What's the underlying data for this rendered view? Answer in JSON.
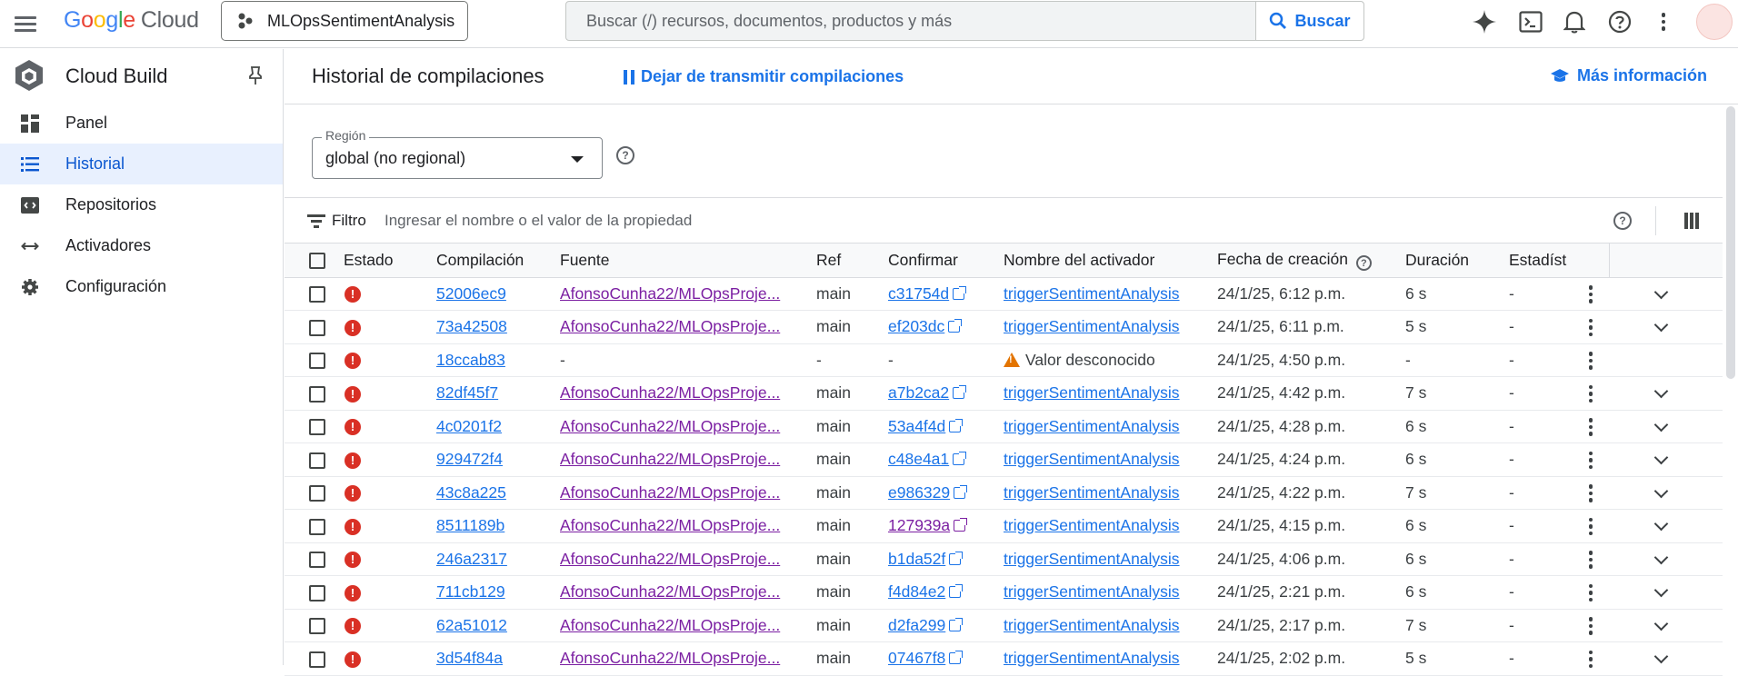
{
  "header": {
    "logo_google": "Google",
    "logo_cloud": "Cloud",
    "project": "MLOpsSentimentAnalysis",
    "search_placeholder": "Buscar (/) recursos, documentos, productos y más",
    "search_button": "Buscar"
  },
  "sidebar": {
    "title": "Cloud Build",
    "items": [
      {
        "label": "Panel",
        "icon": "dashboard-icon"
      },
      {
        "label": "Historial",
        "icon": "list-icon",
        "active": true
      },
      {
        "label": "Repositorios",
        "icon": "repository-icon"
      },
      {
        "label": "Activadores",
        "icon": "trigger-arrows-icon"
      },
      {
        "label": "Configuración",
        "icon": "gear-icon"
      }
    ]
  },
  "page": {
    "title": "Historial de compilaciones",
    "stream_link": "Dejar de transmitir compilaciones",
    "more_info": "Más información",
    "region_label": "Región",
    "region_value": "global (no regional)",
    "filter_label": "Filtro",
    "filter_placeholder": "Ingresar el nombre o el valor de la propiedad"
  },
  "table": {
    "columns": [
      "Estado",
      "Compilación",
      "Fuente",
      "Ref",
      "Confirmar",
      "Nombre del activador",
      "Fecha de creación",
      "Duración",
      "Estadíst"
    ],
    "rows": [
      {
        "build": "52006ec9",
        "source": "AfonsoCunha22/MLOpsProje...",
        "ref": "main",
        "commit": "c31754d",
        "trigger": "triggerSentimentAnalysis",
        "created": "24/1/25, 6:12 p.m.",
        "duration": "6 s",
        "stats": "-",
        "expand": true
      },
      {
        "build": "73a42508",
        "source": "AfonsoCunha22/MLOpsProje...",
        "ref": "main",
        "commit": "ef203dc",
        "trigger": "triggerSentimentAnalysis",
        "created": "24/1/25, 6:11 p.m.",
        "duration": "5 s",
        "stats": "-",
        "expand": true
      },
      {
        "build": "18ccab83",
        "source": "-",
        "ref": "-",
        "commit": "-",
        "trigger": "Valor desconocido",
        "created": "24/1/25, 4:50 p.m.",
        "duration": "-",
        "stats": "-",
        "expand": false,
        "unknown": true
      },
      {
        "build": "82df45f7",
        "source": "AfonsoCunha22/MLOpsProje...",
        "ref": "main",
        "commit": "a7b2ca2",
        "trigger": "triggerSentimentAnalysis",
        "created": "24/1/25, 4:42 p.m.",
        "duration": "7 s",
        "stats": "-",
        "expand": true
      },
      {
        "build": "4c0201f2",
        "source": "AfonsoCunha22/MLOpsProje...",
        "ref": "main",
        "commit": "53a4f4d",
        "trigger": "triggerSentimentAnalysis",
        "created": "24/1/25, 4:28 p.m.",
        "duration": "6 s",
        "stats": "-",
        "expand": true
      },
      {
        "build": "929472f4",
        "source": "AfonsoCunha22/MLOpsProje...",
        "ref": "main",
        "commit": "c48e4a1",
        "trigger": "triggerSentimentAnalysis",
        "created": "24/1/25, 4:24 p.m.",
        "duration": "6 s",
        "stats": "-",
        "expand": true
      },
      {
        "build": "43c8a225",
        "source": "AfonsoCunha22/MLOpsProje...",
        "ref": "main",
        "commit": "e986329",
        "trigger": "triggerSentimentAnalysis",
        "created": "24/1/25, 4:22 p.m.",
        "duration": "7 s",
        "stats": "-",
        "expand": true
      },
      {
        "build": "8511189b",
        "source": "AfonsoCunha22/MLOpsProje...",
        "ref": "main",
        "commit": "127939a",
        "trigger": "triggerSentimentAnalysis",
        "created": "24/1/25, 4:15 p.m.",
        "duration": "6 s",
        "stats": "-",
        "expand": true,
        "visited_commit": true
      },
      {
        "build": "246a2317",
        "source": "AfonsoCunha22/MLOpsProje...",
        "ref": "main",
        "commit": "b1da52f",
        "trigger": "triggerSentimentAnalysis",
        "created": "24/1/25, 4:06 p.m.",
        "duration": "6 s",
        "stats": "-",
        "expand": true
      },
      {
        "build": "711cb129",
        "source": "AfonsoCunha22/MLOpsProje...",
        "ref": "main",
        "commit": "f4d84e2",
        "trigger": "triggerSentimentAnalysis",
        "created": "24/1/25, 2:21 p.m.",
        "duration": "6 s",
        "stats": "-",
        "expand": true
      },
      {
        "build": "62a51012",
        "source": "AfonsoCunha22/MLOpsProje...",
        "ref": "main",
        "commit": "d2fa299",
        "trigger": "triggerSentimentAnalysis",
        "created": "24/1/25, 2:17 p.m.",
        "duration": "7 s",
        "stats": "-",
        "expand": true
      },
      {
        "build": "3d54f84a",
        "source": "AfonsoCunha22/MLOpsProje...",
        "ref": "main",
        "commit": "07467f8",
        "trigger": "triggerSentimentAnalysis",
        "created": "24/1/25, 2:02 p.m.",
        "duration": "5 s",
        "stats": "-",
        "expand": true
      }
    ]
  },
  "colors": {
    "accent": "#1a73e8",
    "error": "#d93025",
    "warning": "#e37400",
    "visited": "#7b1fa2",
    "active_nav_bg": "#e8f0fe"
  }
}
